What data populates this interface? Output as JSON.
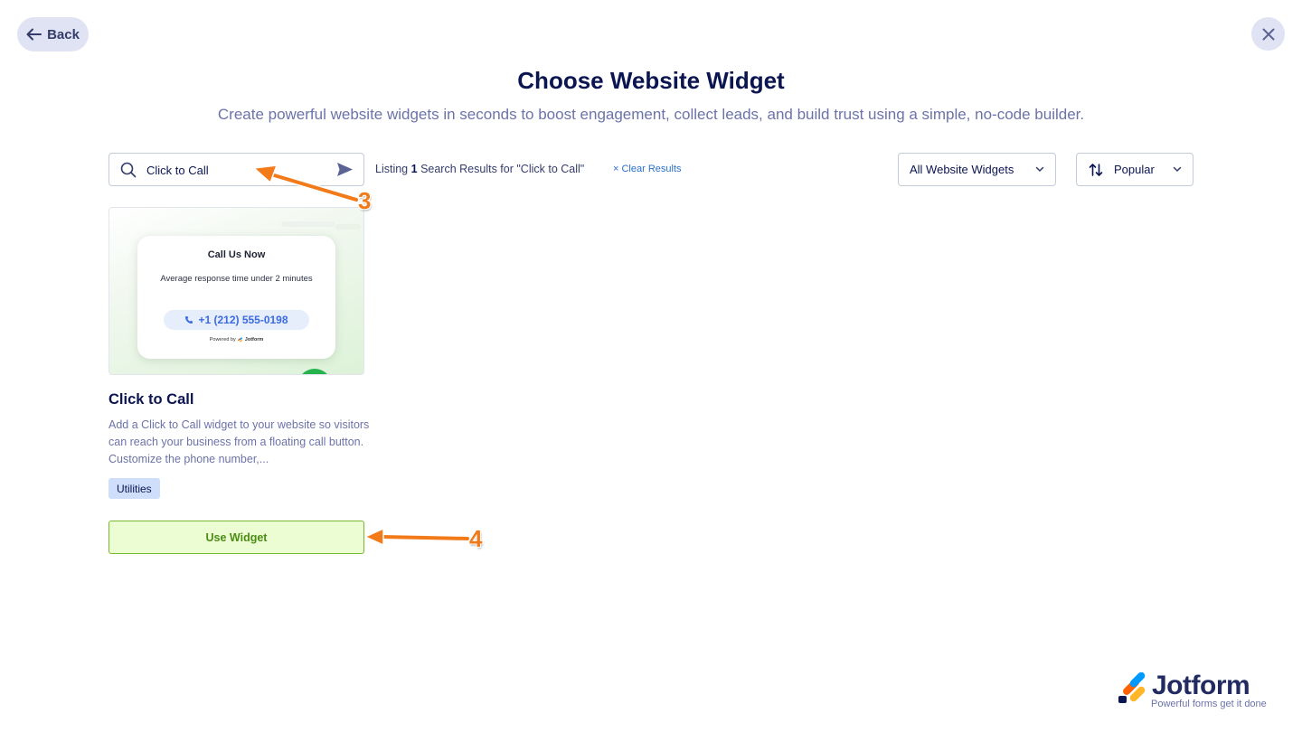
{
  "header": {
    "back_label": "Back",
    "title": "Choose Website Widget",
    "subtitle": "Create powerful website widgets in seconds to boost engagement, collect leads, and build trust using a simple, no-code builder."
  },
  "search": {
    "value": "Click to Call",
    "results_prefix": "Listing",
    "results_count": "1",
    "results_suffix": "Search Results for \"Click to Call\"",
    "clear_label": "Clear Results"
  },
  "filters": {
    "category_selected": "All Website Widgets",
    "sort_selected": "Popular"
  },
  "widget_card": {
    "preview": {
      "title": "Call Us Now",
      "subtitle": "Average response time under 2 minutes",
      "phone": "+1 (212) 555-0198",
      "powered_by": "Powered by",
      "powered_brand": "Jotform"
    },
    "title": "Click to Call",
    "description": "Add a Click to Call widget to your website so visitors can reach your business from a floating call button. Customize the phone number,...",
    "tag": "Utilities",
    "button_label": "Use Widget"
  },
  "annotations": {
    "step_3": "3",
    "step_4": "4",
    "color": "#f27a19"
  },
  "branding": {
    "name": "Jotform",
    "tagline": "Powerful forms get it done"
  },
  "icons": [
    "arrow-left-icon",
    "close-icon",
    "search-icon",
    "send-icon",
    "chevron-down-icon",
    "sort-icon",
    "phone-icon"
  ]
}
